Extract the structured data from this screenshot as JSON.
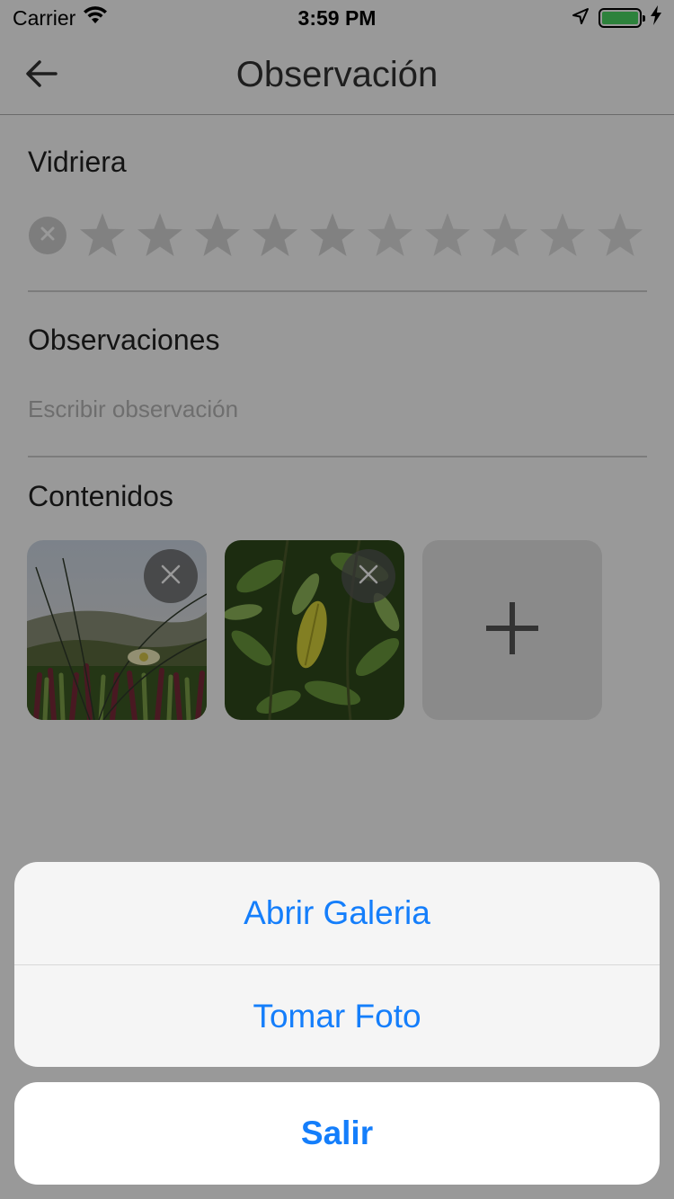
{
  "status_bar": {
    "carrier": "Carrier",
    "time": "3:59 PM",
    "battery_level": 1.0,
    "battery_color": "#4cd964",
    "icons": [
      "wifi-icon",
      "location-arrow-icon",
      "battery-icon",
      "charging-bolt-icon"
    ]
  },
  "navbar": {
    "title": "Observación",
    "back_icon": "arrow-left-icon"
  },
  "rating": {
    "label": "Vidriera",
    "clear_icon": "close-circle-icon",
    "max_stars": 10,
    "value": 0
  },
  "observations": {
    "label": "Observaciones",
    "placeholder": "Escribir observación",
    "value": ""
  },
  "contents": {
    "label": "Contenidos",
    "items": [
      {
        "name": "photo-flower-thumbnail",
        "remove_icon": "close-icon"
      },
      {
        "name": "photo-leaves-thumbnail",
        "remove_icon": "close-icon"
      }
    ],
    "add_icon": "plus-icon"
  },
  "action_sheet": {
    "actions": [
      {
        "label": "Abrir Galeria"
      },
      {
        "label": "Tomar Foto"
      }
    ],
    "cancel_label": "Salir",
    "accent_color": "#147efb"
  }
}
